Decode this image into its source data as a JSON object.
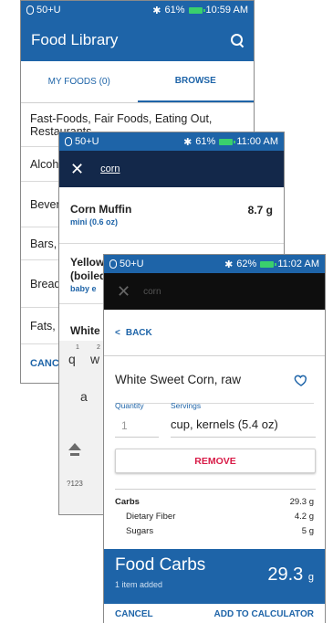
{
  "screen1": {
    "status": {
      "pod": "50+U",
      "battery": "61%",
      "time": "10:59 AM"
    },
    "title": "Food Library",
    "tabs": [
      {
        "label": "MY FOODS (0)"
      },
      {
        "label": "BROWSE"
      }
    ],
    "categories": [
      {
        "label": "Fast-Foods, Fair Foods, Eating Out, Restaurants"
      },
      {
        "label": "Alcohol"
      },
      {
        "label": "Beverages, Shakes"
      },
      {
        "label": "Bars, Bites"
      },
      {
        "label": "Breads, Cookies"
      },
      {
        "label": "Fats, Oils"
      }
    ],
    "cancel": "CANCEL"
  },
  "screen2": {
    "status": {
      "pod": "50+U",
      "battery": "61%",
      "time": "11:00 AM"
    },
    "search_query": "corn",
    "results": [
      {
        "name": "Corn Muffin",
        "sub": "mini (0.6 oz)",
        "value": "8.7 g"
      },
      {
        "name": "Yellow",
        "name2": "(boiled",
        "sub": "baby e"
      },
      {
        "name": "White"
      }
    ],
    "keyboard": {
      "row1": [
        "q",
        "w"
      ],
      "row1_nums": [
        "1",
        "2"
      ],
      "row2": [
        "a"
      ],
      "sym": "?123"
    }
  },
  "screen3": {
    "status": {
      "pod": "50+U",
      "battery": "62%",
      "time": "11:02 AM"
    },
    "search_query": "corn",
    "back": "BACK",
    "food_name": "White Sweet Corn, raw",
    "quantity_label": "Quantity",
    "servings_label": "Servings",
    "quantity_value": "1",
    "servings_value": "cup, kernels (5.4 oz)",
    "remove": "REMOVE",
    "nutrition": {
      "carbs_label": "Carbs",
      "carbs_value": "29.3 g",
      "fiber_label": "Dietary Fiber",
      "fiber_value": "4.2 g",
      "sugars_label": "Sugars",
      "sugars_value": "5 g"
    },
    "footer": {
      "title": "Food Carbs",
      "sub": "1 item added",
      "value": "29.3",
      "unit": "g"
    },
    "cancel": "CANCEL",
    "add": "ADD TO CALCULATOR"
  },
  "colors": {
    "primary": "#1e64a8",
    "dark_search": "#13284a",
    "remove_red": "#d81b47",
    "battery_green": "#3ad06d"
  }
}
